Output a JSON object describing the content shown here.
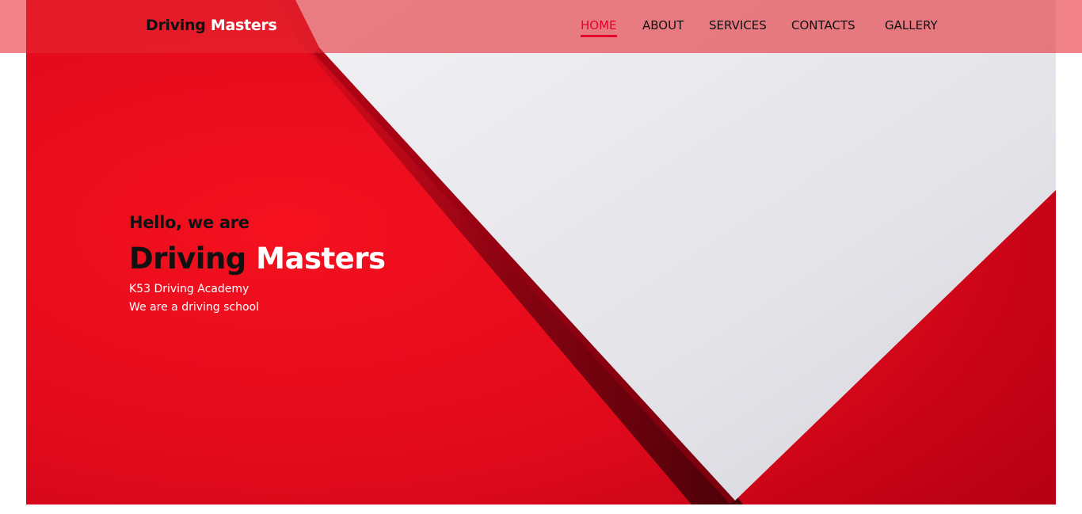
{
  "navbar": {
    "brand_part1": "Driving",
    "brand_part2": "Masters",
    "links": [
      {
        "label": "HOME",
        "active": true
      },
      {
        "label": "ABOUT",
        "active": false
      },
      {
        "label": "SERVICES",
        "active": false
      },
      {
        "label": "CONTACTS",
        "active": false
      },
      {
        "label": "GALLERY",
        "active": false
      }
    ]
  },
  "hero": {
    "greeting": "Hello, we are",
    "title_part1": "Driving",
    "title_part2": "Masters",
    "line1": "K53 Driving Academy",
    "line2": "We are a driving school"
  },
  "colors": {
    "accent": "#e4002b",
    "hero_red": "#e8101e",
    "navbar_overlay": "#ee7070"
  }
}
